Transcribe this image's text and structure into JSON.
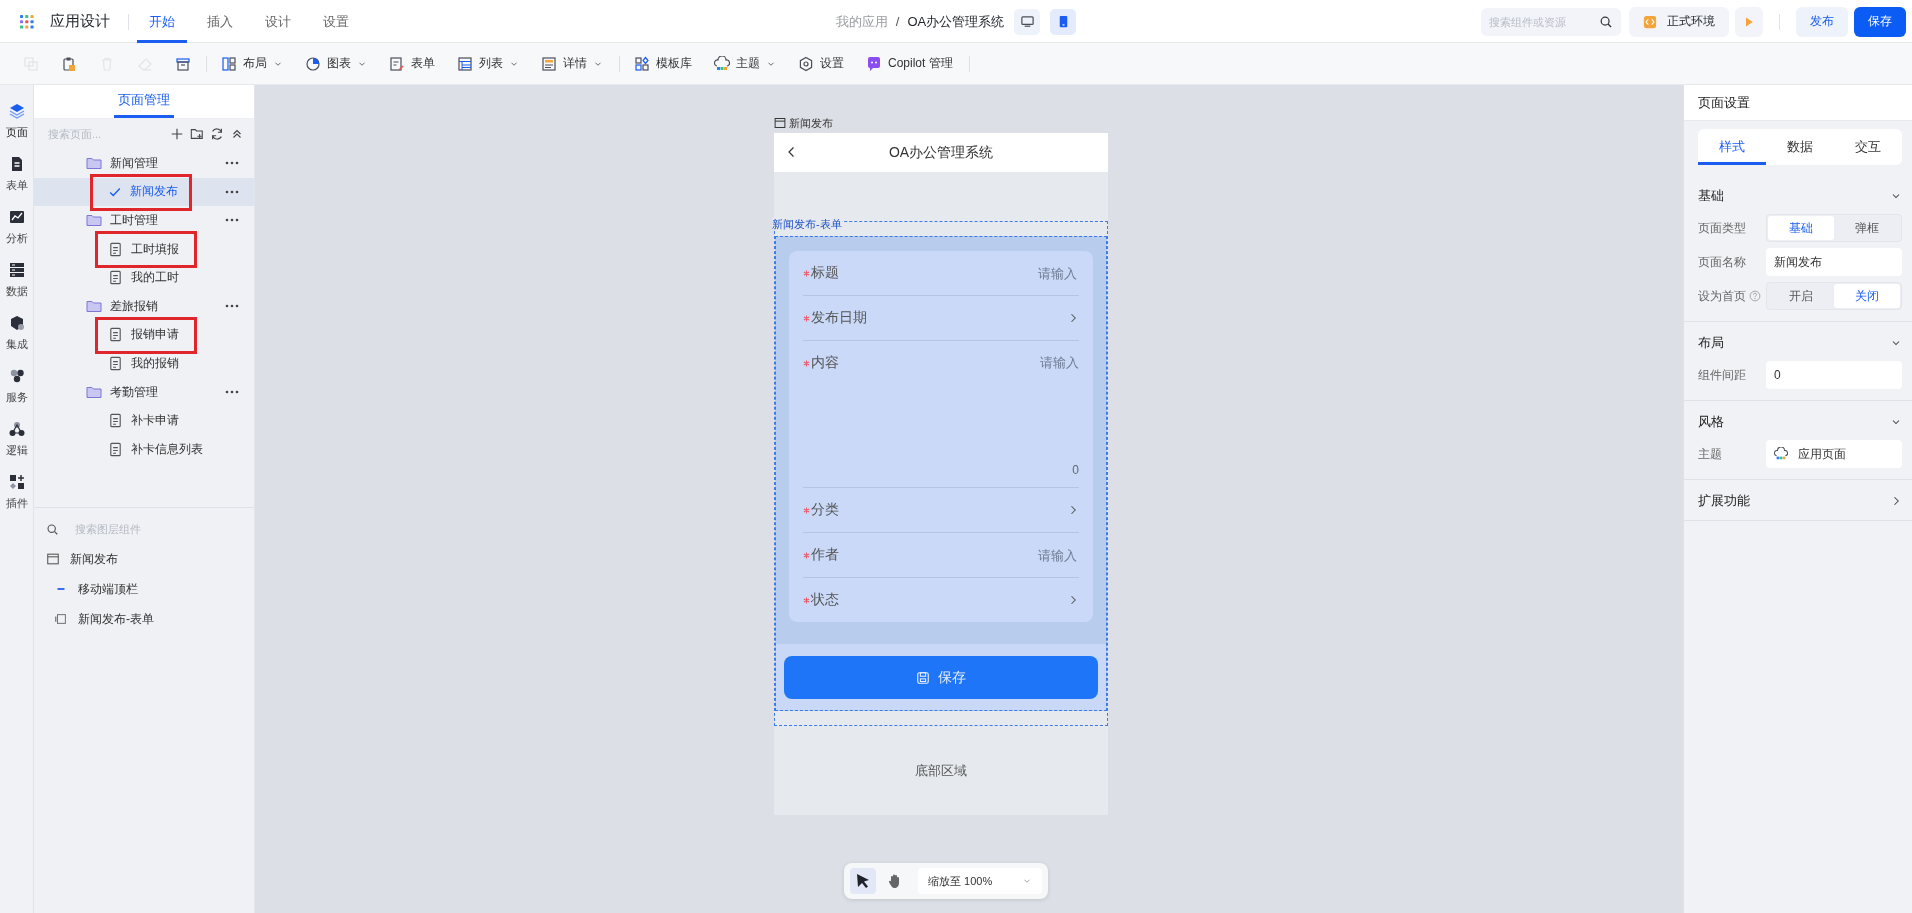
{
  "topbar": {
    "app_title": "应用设计",
    "menu": [
      {
        "label": "开始",
        "selected": true
      },
      {
        "label": "插入",
        "selected": false
      },
      {
        "label": "设计",
        "selected": false
      },
      {
        "label": "设置",
        "selected": false
      }
    ],
    "breadcrumb": [
      "我的应用",
      "OA办公管理系统"
    ],
    "breadcrumb_separator": "/",
    "view_modes": [
      {
        "selected": false
      },
      {
        "selected": true
      }
    ],
    "search": {
      "placeholder": "搜索组件或资源"
    },
    "environment": "正式环境",
    "publish": "发布",
    "save": "保存"
  },
  "toolbar": {
    "groups": [
      [
        {
          "disabled": true
        },
        {
          "disabled": false
        },
        {
          "disabled": true
        },
        {
          "disabled": true
        },
        {
          "disabled": false
        }
      ],
      [
        {
          "label": "布局",
          "dropdown": true,
          "disabled": false
        },
        {
          "label": "图表",
          "dropdown": true,
          "disabled": false
        },
        {
          "label": "表单",
          "dropdown": false,
          "disabled": false
        },
        {
          "label": "列表",
          "dropdown": true,
          "disabled": false
        },
        {
          "label": "详情",
          "dropdown": true,
          "disabled": false
        }
      ],
      [
        {
          "label": "模板库",
          "dropdown": false,
          "disabled": false
        },
        {
          "label": "主题",
          "dropdown": true,
          "disabled": false
        },
        {
          "label": "设置",
          "dropdown": false,
          "disabled": false
        },
        {
          "label": "Copilot 管理",
          "dropdown": false,
          "disabled": false
        }
      ]
    ]
  },
  "rail": [
    {
      "label": "页面",
      "selected": true
    },
    {
      "label": "表单",
      "selected": false
    },
    {
      "label": "分析",
      "selected": false
    },
    {
      "label": "数据",
      "selected": false
    },
    {
      "label": "集成",
      "selected": false
    },
    {
      "label": "服务",
      "selected": false
    },
    {
      "label": "逻辑",
      "selected": false
    },
    {
      "label": "插件",
      "selected": false
    }
  ],
  "page_panel": {
    "title": "页面管理",
    "search": {
      "placeholder": "搜索页面..."
    },
    "tree": [
      {
        "label": "新闻管理",
        "kind": "folder",
        "selected": false,
        "has_menu": true,
        "highlighted": false,
        "children": [
          {
            "label": "新闻发布",
            "kind": "page",
            "selected": true,
            "has_menu": true,
            "highlighted": true
          }
        ]
      },
      {
        "label": "工时管理",
        "kind": "folder",
        "selected": false,
        "has_menu": true,
        "highlighted": false,
        "children": [
          {
            "label": "工时填报",
            "kind": "page",
            "selected": false,
            "has_menu": false,
            "highlighted": true
          },
          {
            "label": "我的工时",
            "kind": "page",
            "selected": false,
            "has_menu": false,
            "highlighted": false
          }
        ]
      },
      {
        "label": "差旅报销",
        "kind": "folder",
        "selected": false,
        "has_menu": true,
        "highlighted": false,
        "children": [
          {
            "label": "报销申请",
            "kind": "page",
            "selected": false,
            "has_menu": false,
            "highlighted": true
          },
          {
            "label": "我的报销",
            "kind": "page",
            "selected": false,
            "has_menu": false,
            "highlighted": false
          }
        ]
      },
      {
        "label": "考勤管理",
        "kind": "folder",
        "selected": false,
        "has_menu": true,
        "highlighted": false,
        "children": [
          {
            "label": "补卡申请",
            "kind": "page",
            "selected": false,
            "has_menu": false,
            "highlighted": false
          },
          {
            "label": "补卡信息列表",
            "kind": "page",
            "selected": false,
            "has_menu": false,
            "highlighted": false
          }
        ]
      }
    ],
    "layers": {
      "search": {
        "placeholder": "搜索图层组件"
      },
      "tree": [
        {
          "label": "新闻发布",
          "kind": "page",
          "children": [
            {
              "label": "移动端顶栏",
              "kind": "navbar"
            },
            {
              "label": "新闻发布-表单",
              "kind": "form"
            }
          ]
        }
      ]
    }
  },
  "canvas": {
    "page_label": "新闻发布",
    "nav_title": "OA办公管理系统",
    "form_label": "新闻发布-表单",
    "fields": [
      {
        "label": "标题",
        "required": true,
        "kind": "input",
        "placeholder": "请输入"
      },
      {
        "label": "发布日期",
        "required": true,
        "kind": "picker"
      },
      {
        "label": "内容",
        "required": true,
        "kind": "textarea",
        "placeholder": "请输入",
        "count": "0"
      },
      {
        "label": "分类",
        "required": true,
        "kind": "picker"
      },
      {
        "label": "作者",
        "required": true,
        "kind": "input",
        "placeholder": "请输入"
      },
      {
        "label": "状态",
        "required": true,
        "kind": "picker"
      }
    ],
    "submit": "保存",
    "footer": "底部区域",
    "tools": [
      {
        "kind": "pointer",
        "selected": true
      },
      {
        "kind": "hand",
        "selected": false
      }
    ],
    "zoom": "缩放至 100%"
  },
  "settings": {
    "title": "页面设置",
    "tabs": [
      {
        "label": "样式",
        "selected": true
      },
      {
        "label": "数据",
        "selected": false
      },
      {
        "label": "交互",
        "selected": false
      }
    ],
    "sections": [
      {
        "title": "基础",
        "expanded": true,
        "rows": [
          {
            "label": "页面类型",
            "kind": "segmented",
            "options": [
              {
                "label": "基础",
                "selected": true
              },
              {
                "label": "弹框",
                "selected": false
              }
            ]
          },
          {
            "label": "页面名称",
            "kind": "input",
            "value": "新闻发布"
          },
          {
            "label": "设为首页",
            "help": true,
            "kind": "segmented",
            "options": [
              {
                "label": "开启",
                "selected": false
              },
              {
                "label": "关闭",
                "selected": true
              }
            ]
          }
        ]
      },
      {
        "title": "布局",
        "expanded": true,
        "rows": [
          {
            "label": "组件间距",
            "kind": "input",
            "value": "0"
          }
        ]
      },
      {
        "title": "风格",
        "expanded": true,
        "rows": [
          {
            "label": "主题",
            "kind": "theme",
            "value": "应用页面"
          }
        ]
      },
      {
        "title": "扩展功能",
        "expanded": false
      }
    ]
  }
}
